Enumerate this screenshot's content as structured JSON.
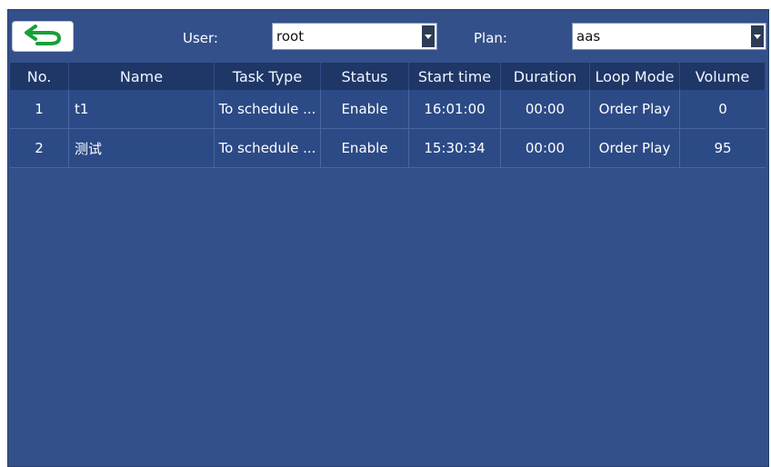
{
  "toolbar": {
    "back_icon": "back-arrow-icon",
    "user_label": "User:",
    "user_value": "root",
    "plan_label": "Plan:",
    "plan_value": "aas"
  },
  "table": {
    "headers": [
      "No.",
      "Name",
      "Task Type",
      "Status",
      "Start time",
      "Duration",
      "Loop Mode",
      "Volume"
    ],
    "rows": [
      [
        "1",
        "t1",
        "To schedule ...",
        "Enable",
        "16:01:00",
        "00:00",
        "Order Play",
        "0"
      ],
      [
        "2",
        "测试",
        "To schedule ...",
        "Enable",
        "15:30:34",
        "00:00",
        "Order Play",
        "95"
      ]
    ]
  },
  "colors": {
    "background": "#33508a",
    "header": "#1f3766",
    "row": "#2c4a86",
    "back_arrow": "#1a9e3a"
  }
}
